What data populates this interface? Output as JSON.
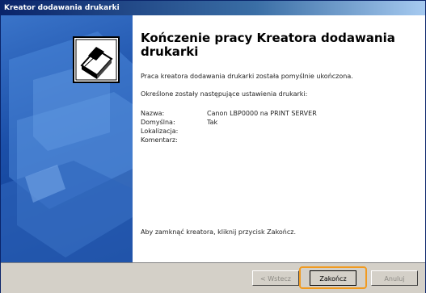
{
  "window": {
    "title": "Kreator dodawania drukarki"
  },
  "content": {
    "heading": "Kończenie pracy Kreatora dodawania drukarki",
    "success_text": "Praca kreatora dodawania drukarki została pomyślnie ukończona.",
    "settings_intro": "Określone zostały następujące ustawienia drukarki:",
    "settings": [
      {
        "label": "Nazwa:",
        "value": "Canon LBP0000 na PRINT SERVER"
      },
      {
        "label": "Domyślna:",
        "value": "Tak"
      },
      {
        "label": "Lokalizacja:",
        "value": ""
      },
      {
        "label": "Komentarz:",
        "value": ""
      }
    ],
    "close_hint": "Aby zamknąć kreatora, kliknij przycisk Zakończ."
  },
  "buttons": {
    "back": "< Wstecz",
    "finish": "Zakończ",
    "cancel": "Anuluj"
  },
  "colors": {
    "highlight": "#f19a1f",
    "sidebar": "#1b4fa8"
  },
  "icons": {
    "wizard": "printer-icon"
  }
}
